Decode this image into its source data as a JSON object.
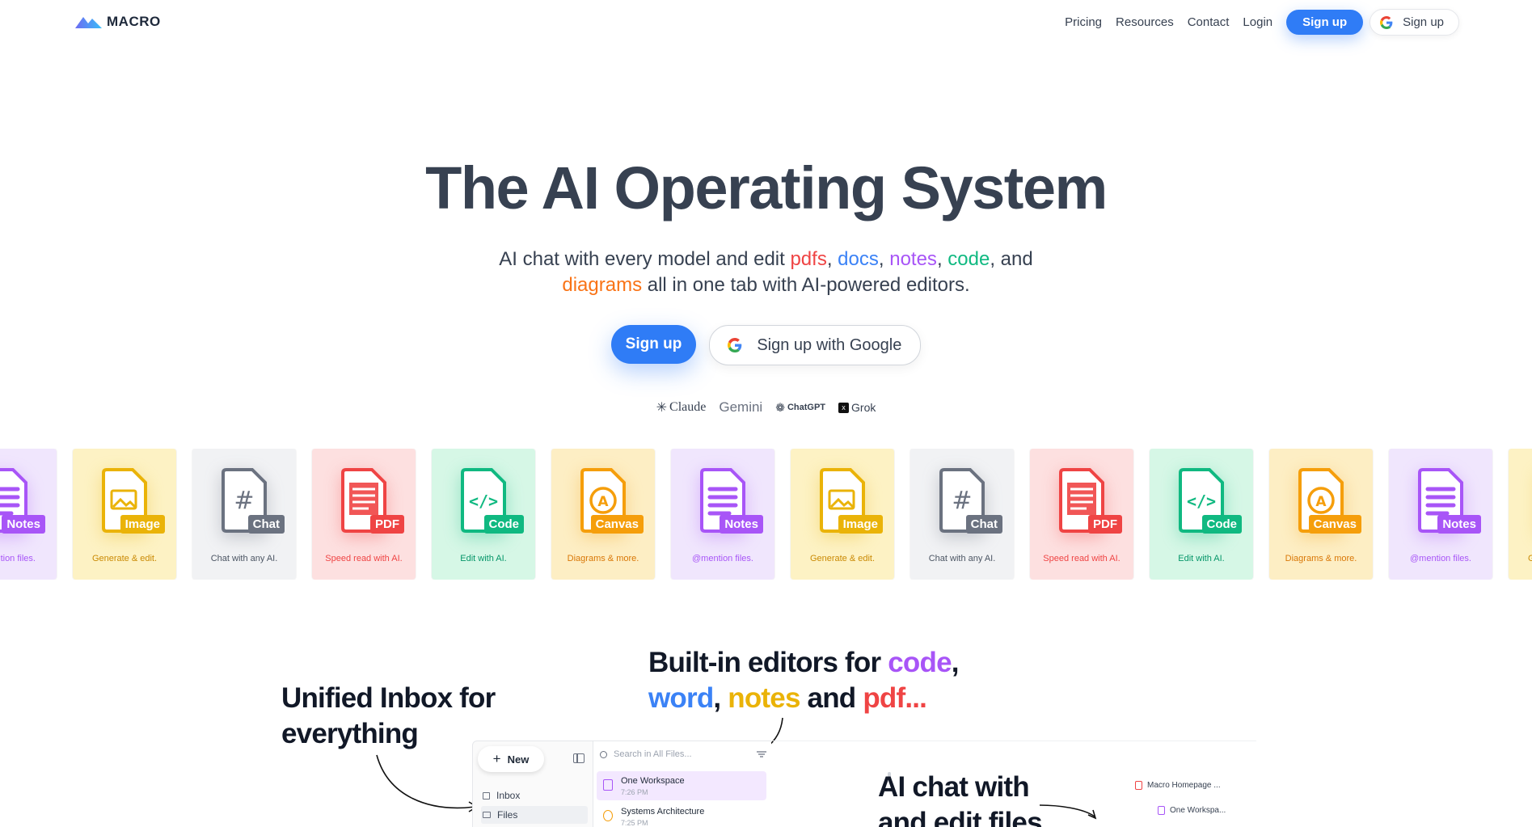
{
  "nav": {
    "logo_text": "MACRO",
    "links": [
      "Pricing",
      "Resources",
      "Contact",
      "Login"
    ],
    "signup_label": "Sign up",
    "google_signup_label": "Sign up"
  },
  "hero": {
    "title": "The AI Operating System",
    "sub_prefix": "AI chat with every model and edit ",
    "w_pdfs": "pdfs",
    "w_docs": "docs",
    "w_notes": "notes",
    "w_code": "code",
    "sub_and": ", and",
    "w_diagrams": "diagrams",
    "sub_suffix": " all in one tab with AI-powered editors.",
    "signup_label": "Sign up",
    "google_signup_label": "Sign up with Google"
  },
  "models": [
    "Claude",
    "Gemini",
    "ChatGPT",
    "Grok"
  ],
  "cards": [
    {
      "tag": "Notes",
      "caption": "@mention files.",
      "kind": "notes"
    },
    {
      "tag": "Image",
      "caption": "Generate & edit.",
      "kind": "image"
    },
    {
      "tag": "Chat",
      "caption": "Chat with any AI.",
      "kind": "chat"
    },
    {
      "tag": "PDF",
      "caption": "Speed read with AI.",
      "kind": "pdf"
    },
    {
      "tag": "Code",
      "caption": "Edit with AI.",
      "kind": "code"
    },
    {
      "tag": "Canvas",
      "caption": "Diagrams & more.",
      "kind": "canvas"
    }
  ],
  "colors": {
    "notes": {
      "bg": "#f0e6fd",
      "fg": "#a855f7",
      "text": "#a855f7"
    },
    "image": {
      "bg": "#fdf2c4",
      "fg": "#eab308",
      "text": "#ca8a04"
    },
    "chat": {
      "bg": "#f1f2f4",
      "fg": "#6b7280",
      "text": "#4b5563"
    },
    "pdf": {
      "bg": "#fde0e0",
      "fg": "#ef4444",
      "text": "#ef4444"
    },
    "code": {
      "bg": "#d6f7e6",
      "fg": "#10b981",
      "text": "#059669"
    },
    "canvas": {
      "bg": "#fdeec4",
      "fg": "#f59e0b",
      "text": "#d97706"
    }
  },
  "sections": {
    "inbox_line1": "Unified Inbox for",
    "inbox_line2": "everything",
    "editors_line1": "Built-in editors for ",
    "editors_code": "code",
    "editors_comma": ",",
    "editors_word": "word",
    "editors_comma2": ", ",
    "editors_notes": "notes",
    "editors_and": " and ",
    "editors_pdf": "pdf...",
    "aichat_line1": "AI chat with",
    "aichat_line2": "and edit files"
  },
  "app": {
    "new_label": "New",
    "sidebar": [
      "Inbox",
      "Files"
    ],
    "search_placeholder": "Search in All Files...",
    "files": [
      {
        "name": "One Workspace",
        "time": "7:26 PM"
      },
      {
        "name": "Systems Architecture",
        "time": "7:25 PM"
      }
    ],
    "right_links": [
      "Macro Homepage ...",
      "One Workspa..."
    ]
  }
}
